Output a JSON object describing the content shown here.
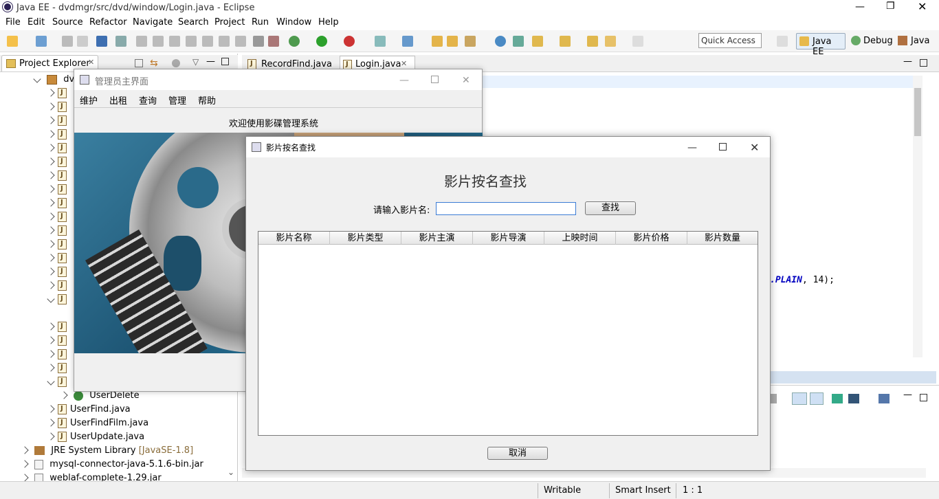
{
  "window": {
    "title": "Java EE - dvdmgr/src/dvd/window/Login.java - Eclipse"
  },
  "menubar": [
    "File",
    "Edit",
    "Source",
    "Refactor",
    "Navigate",
    "Search",
    "Project",
    "Run",
    "Window",
    "Help"
  ],
  "toolbar": {
    "quick_access_placeholder": "Quick Access",
    "perspectives": [
      "Java EE",
      "Debug",
      "Java"
    ]
  },
  "project_explorer": {
    "tab_label": "Project Explorer",
    "project_name": "dvd",
    "items": [
      {
        "label": "UserDelete"
      },
      {
        "label": "UserFind.java"
      },
      {
        "label": "UserFindFilm.java"
      },
      {
        "label": "UserUpdate.java"
      },
      {
        "label": "JRE System Library",
        "suffix": "[JavaSE-1.8]"
      },
      {
        "label": "mysql-connector-java-5.1.6-bin.jar"
      },
      {
        "label": "weblaf-complete-1.29.jar"
      }
    ]
  },
  "editor": {
    "tabs": [
      "RecordFind.java",
      "Login.java"
    ],
    "code_fragment_a": ".PLAIN",
    "code_fragment_b": ", 14);"
  },
  "statusbar": {
    "writable": "Writable",
    "insert_mode": "Smart Insert",
    "position": "1 : 1"
  },
  "admin_window": {
    "title": "管理员主界面",
    "menu": [
      "维护",
      "出租",
      "查询",
      "管理",
      "帮助"
    ],
    "welcome": "欢迎使用影碟管理系统"
  },
  "search_dialog": {
    "title": "影片按名查找",
    "heading": "影片按名查找",
    "input_label": "请输入影片名:",
    "input_value": "",
    "search_button": "查找",
    "cancel_button": "取消",
    "columns": [
      "影片名称",
      "影片类型",
      "影片主演",
      "影片导演",
      "上映时间",
      "影片价格",
      "影片数量"
    ]
  },
  "colors": {
    "accent": "#0b6fb5",
    "suffix_color": "#8a6d3b",
    "code_keyword": "#0000c0"
  }
}
